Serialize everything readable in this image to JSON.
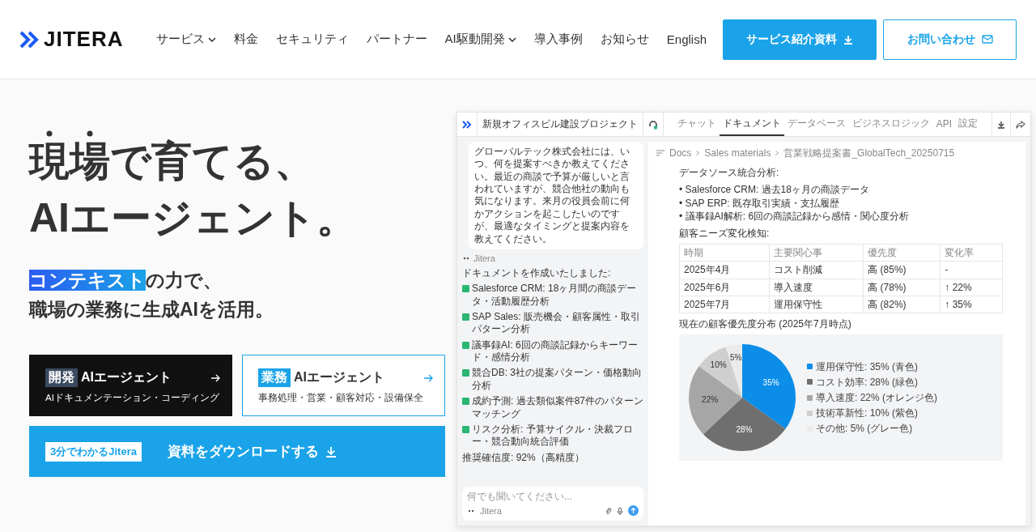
{
  "header": {
    "logo": "JITERA",
    "nav": [
      {
        "label": "サービス",
        "dropdown": true
      },
      {
        "label": "料金",
        "dropdown": false
      },
      {
        "label": "セキュリティ",
        "dropdown": false
      },
      {
        "label": "パートナー",
        "dropdown": false
      },
      {
        "label": "AI駆動開発",
        "dropdown": true
      },
      {
        "label": "導入事例",
        "dropdown": false
      },
      {
        "label": "お知らせ",
        "dropdown": false
      },
      {
        "label": "English",
        "dropdown": false
      }
    ],
    "buttons": [
      {
        "label": "サービス紹介資料",
        "kind": "primary"
      },
      {
        "label": "お問い合わせ",
        "kind": "outline"
      }
    ]
  },
  "hero": {
    "title_lines": [
      [
        {
          "text": "現場",
          "emphasis": true
        },
        {
          "text": "で育てる、",
          "emphasis": false
        }
      ],
      [
        {
          "text": "AIエージェント。",
          "emphasis": false
        }
      ]
    ],
    "subtitle_lines": [
      [
        {
          "text": "コンテキスト",
          "highlight": true
        },
        {
          "text": "の力で、",
          "highlight": false
        }
      ],
      [
        {
          "text": "職場の業務に生成AIを活用。",
          "highlight": false
        }
      ]
    ],
    "cards": [
      {
        "tag": "開発",
        "title": "AIエージェント",
        "subtitle": "AIドキュメンテーション・コーディング",
        "kind": "dark"
      },
      {
        "tag": "業務",
        "title": "AIエージェント",
        "subtitle": "事務処理・営業・顧客対応・設備保全",
        "kind": "light"
      }
    ],
    "banner": {
      "badge": "3分でわかるJitera",
      "label": "資料をダウンロードする"
    }
  },
  "app": {
    "project": "新規オフィスビル建設プロジェクト",
    "tabs": [
      {
        "label": "チャット",
        "selected": false
      },
      {
        "label": "ドキュメント",
        "selected": true
      },
      {
        "label": "データベース",
        "selected": false
      },
      {
        "label": "ビジネスロジック",
        "selected": false
      },
      {
        "label": "API",
        "selected": false
      },
      {
        "label": "設定",
        "selected": false
      }
    ],
    "chat": {
      "bubble": "グローバルテック株式会社には、いつ、何を提案すべきか教えてください。最近の商談で予算が厳しいと言われていますが、競合他社の動向も気になります。来月の役員会前に何かアクションを起こしたいのですが、最適なタイミングと提案内容を教えてください。",
      "sender": "Jitera",
      "intro": "ドキュメントを作成いたしました:",
      "checklist": [
        {
          "text": "Salesforce CRM: 18ヶ月間の商談データ・活動履歴分析",
          "checked": true
        },
        {
          "text": "SAP Sales: 販売機会・顧客属性・取引パターン分析",
          "checked": true
        },
        {
          "text": "議事録AI: 6回の商談記録からキーワード・感情分析",
          "checked": true
        },
        {
          "text": "競合DB: 3社の提案パターン・価格動向分析",
          "checked": true
        },
        {
          "text": "成約予測: 過去類似案件87件のパターンマッチング",
          "checked": true
        },
        {
          "text": "リスク分析: 予算サイクル・決裁フロー・競合動向統合評価",
          "checked": true
        }
      ],
      "confidence": "推奨確信度: 92%（高精度）",
      "input": {
        "placeholder": "何でも聞いてください...",
        "sender": "Jitera"
      }
    },
    "doc": {
      "breadcrumb": [
        "Docs",
        "Sales materials",
        "営業戦略提案書_GlobalTech_20250715"
      ],
      "sources_heading": "データソース統合分析:",
      "sources": [
        "• Salesforce CRM: 過去18ヶ月の商談データ",
        "• SAP ERP: 既存取引実績・支払履歴",
        "• 議事録AI解析: 6回の商談記録から感情・関心度分析"
      ],
      "needs_heading": "顧客ニーズ変化検知:",
      "table": {
        "columns": [
          "時期",
          "主要関心事",
          "優先度",
          "変化率"
        ],
        "rows": [
          [
            "2025年4月",
            "コスト削減",
            "高 (85%)",
            "-"
          ],
          [
            "2025年6月",
            "導入速度",
            "高 (78%)",
            "↑ 22%"
          ],
          [
            "2025年7月",
            "運用保守性",
            "高 (82%)",
            "↑ 35%"
          ]
        ]
      },
      "chart_heading": "現在の顧客優先度分布 (2025年7月時点)",
      "chart_data": {
        "type": "pie",
        "legend": "right",
        "categories": [
          "運用保守性: 35% (青色)",
          "コスト効率: 28% (緑色)",
          "導入速度: 22% (オレンジ色)",
          "技術革新性: 10% (紫色)",
          "その他: 5% (グレー色)"
        ],
        "values": [
          35,
          28,
          22,
          10,
          5
        ],
        "colors": [
          "#0b8de8",
          "#6f6f6f",
          "#a6a6a6",
          "#cfcfcf",
          "#ebebeb"
        ],
        "value_labels": [
          "35%",
          "28%",
          "22%",
          "10%",
          "5%"
        ]
      }
    }
  }
}
